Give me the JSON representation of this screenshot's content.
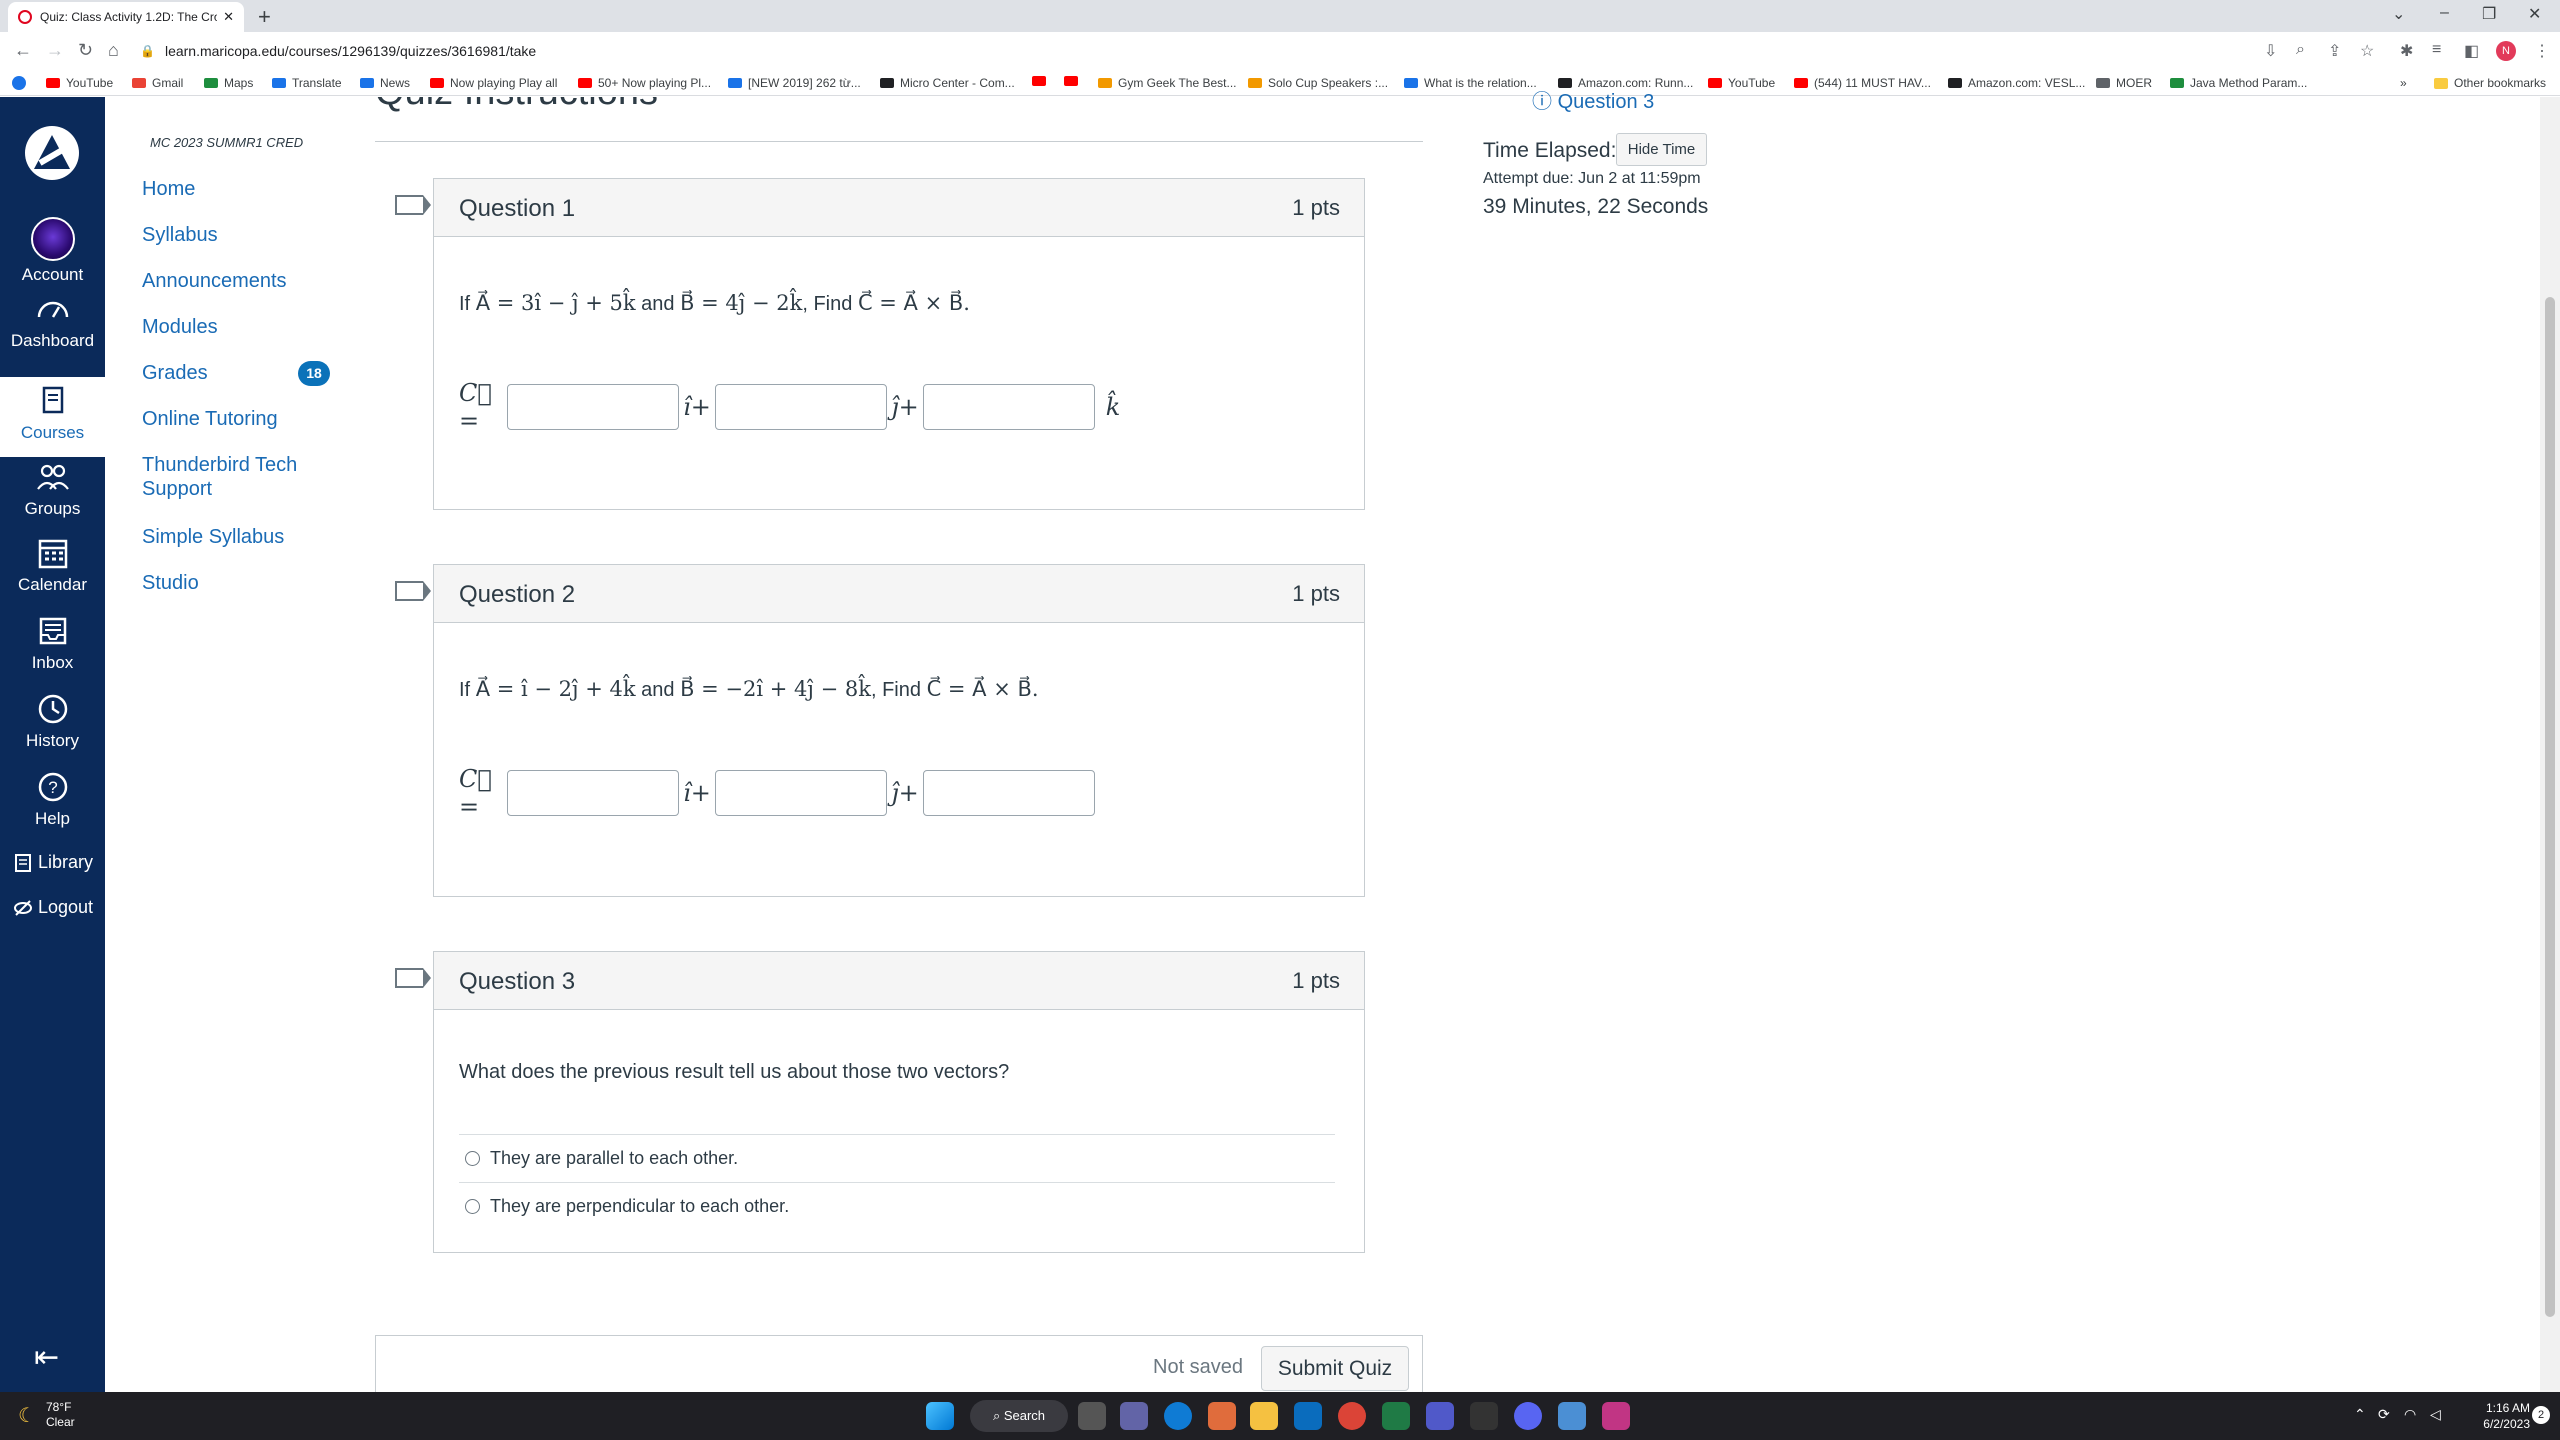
{
  "browser": {
    "tab_title": "Quiz: Class Activity 1.2D: The Cro",
    "url": "learn.maricopa.edu/courses/1296139/quizzes/3616981/take",
    "profile_initial": "N",
    "bookmarks": [
      {
        "label": "YouTube",
        "icon": "youtube-icon"
      },
      {
        "label": "Gmail",
        "icon": "gmail-icon"
      },
      {
        "label": "Maps",
        "icon": "maps-icon"
      },
      {
        "label": "Translate",
        "icon": "translate-icon"
      },
      {
        "label": "News",
        "icon": "news-icon"
      },
      {
        "label": "Now playing Play all",
        "icon": "youtube-icon"
      },
      {
        "label": "50+ Now playing Pl...",
        "icon": "youtube-icon"
      },
      {
        "label": "[NEW 2019] 262 từ...",
        "icon": "doc-icon"
      },
      {
        "label": "Micro Center - Com...",
        "icon": "microcenter-icon"
      },
      {
        "label": "",
        "icon": "youtube-icon"
      },
      {
        "label": "",
        "icon": "youtube-icon"
      },
      {
        "label": "Gym Geek The Best...",
        "icon": "gymgeek-icon"
      },
      {
        "label": "Solo Cup Speakers :...",
        "icon": "solocup-icon"
      },
      {
        "label": "What is the relation...",
        "icon": "web-icon"
      },
      {
        "label": "Amazon.com: Runn...",
        "icon": "amazon-icon"
      },
      {
        "label": "YouTube",
        "icon": "youtube-icon"
      },
      {
        "label": "(544) 11 MUST HAV...",
        "icon": "youtube-icon"
      },
      {
        "label": "Amazon.com: VESL...",
        "icon": "amazon-icon"
      },
      {
        "label": "MOER",
        "icon": "moer-icon"
      },
      {
        "label": "Java Method Param...",
        "icon": "w3-icon"
      }
    ],
    "other_bookmarks": "Other bookmarks"
  },
  "global_nav": {
    "items": [
      {
        "label": "Account"
      },
      {
        "label": "Dashboard"
      },
      {
        "label": "Courses"
      },
      {
        "label": "Groups"
      },
      {
        "label": "Calendar"
      },
      {
        "label": "Inbox"
      },
      {
        "label": "History"
      },
      {
        "label": "Help"
      },
      {
        "label": "Library"
      },
      {
        "label": "Logout"
      }
    ]
  },
  "course_nav": {
    "course_code": "MC 2023 SUMMR1 CRED",
    "links": [
      "Home",
      "Syllabus",
      "Announcements",
      "Modules",
      "Grades",
      "Online Tutoring",
      "Thunderbird Tech Support",
      "Simple Syllabus",
      "Studio"
    ],
    "grades_badge": "18"
  },
  "main": {
    "instructions_title": "Quiz Instructions",
    "questions": [
      {
        "name": "Question 1",
        "points": "1 pts",
        "prefix": "If",
        "a_expr": "A⃗ = 3î − ĵ + 5k̂",
        "and": "and",
        "b_expr": "B⃗ = 4ĵ − 2k̂",
        "find": ", Find",
        "c_expr": "C⃗ = A⃗ × B⃗.",
        "answer_label": "C⃗ =",
        "units": [
          "î+",
          "ĵ+",
          "k̂"
        ]
      },
      {
        "name": "Question 2",
        "points": "1 pts",
        "prefix": "If",
        "a_expr": "A⃗ = î − 2ĵ + 4k̂",
        "and": "and",
        "b_expr": "B⃗ = −2î + 4ĵ − 8k̂",
        "find": ", Find",
        "c_expr": "C⃗ = A⃗ × B⃗.",
        "answer_label": "C⃗ =",
        "units": [
          "î+",
          "ĵ+"
        ]
      },
      {
        "name": "Question 3",
        "points": "1 pts",
        "text": "What does the previous result tell us about those two vectors?",
        "options": [
          "They are parallel to each other.",
          "They are perpendicular to each other."
        ]
      }
    ],
    "not_saved": "Not saved",
    "submit_label": "Submit Quiz"
  },
  "sidebar": {
    "question_link": "Question 3",
    "time_elapsed_label": "Time Elapsed:",
    "hide_time": "Hide Time",
    "attempt_due": "Attempt due: Jun 2 at 11:59pm",
    "elapsed": "39 Minutes, 22 Seconds"
  },
  "taskbar": {
    "temp": "78°F",
    "condition": "Clear",
    "search": "Search",
    "time": "1:16 AM",
    "date": "6/2/2023",
    "notification_count": "2"
  },
  "colors": {
    "nav_bg": "#0b2a5a",
    "link": "#1a6bb5",
    "badge": "#0b72b9"
  }
}
